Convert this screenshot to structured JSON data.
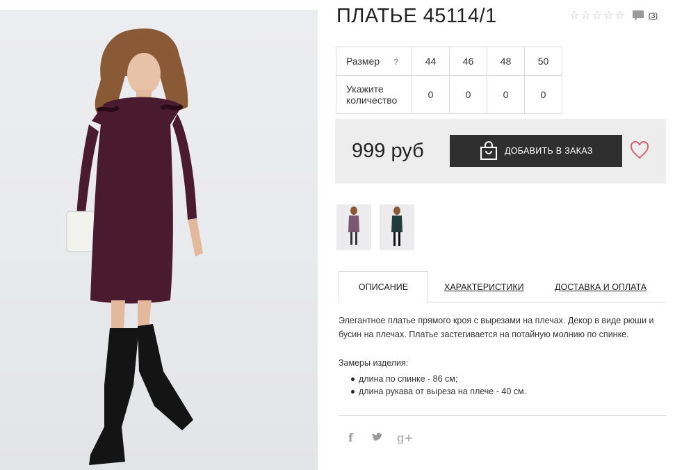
{
  "product": {
    "title": "ПЛАТЬЕ 45114/1",
    "rating": {
      "stars_filled": 0,
      "stars_total": 5,
      "comments_count": "(3)"
    },
    "colors": {
      "dress": "#4a1a2e",
      "accent_heart": "#d0667a",
      "button_bg": "#2f2f2f",
      "price_bar_bg": "#ededed"
    }
  },
  "size_table": {
    "size_label": "Размер",
    "help_symbol": "?",
    "sizes": [
      "44",
      "46",
      "48",
      "50"
    ],
    "quantity_label_line1": "Укажите",
    "quantity_label_line2": "количество",
    "quantities": [
      "0",
      "0",
      "0",
      "0"
    ]
  },
  "purchase": {
    "price": "999 руб",
    "order_button_label": "ДОБАВИТЬ В ЗАКАЗ",
    "order_icon": "shopping-bag-icon",
    "wishlist_icon": "heart-icon"
  },
  "tabs": [
    {
      "label": "ОПИСАНИЕ",
      "active": true
    },
    {
      "label": "ХАРАКТЕРИСТИКИ",
      "active": false
    },
    {
      "label": "ДОСТАВКА И ОПЛАТА",
      "active": false
    }
  ],
  "description": {
    "text": "Элегантное платье прямого кроя с вырезами на плечах. Декор в виде рюши и бусин на плечах. Платье застегивается на потайную молнию по спинке.",
    "measures_title": "Замеры изделия:",
    "measures": [
      "длина по спинке - 86 см;",
      "длина рукава от выреза на плече - 40 см."
    ]
  },
  "social": {
    "facebook": "f",
    "twitter": "twitter-icon",
    "google_plus": "g+"
  }
}
